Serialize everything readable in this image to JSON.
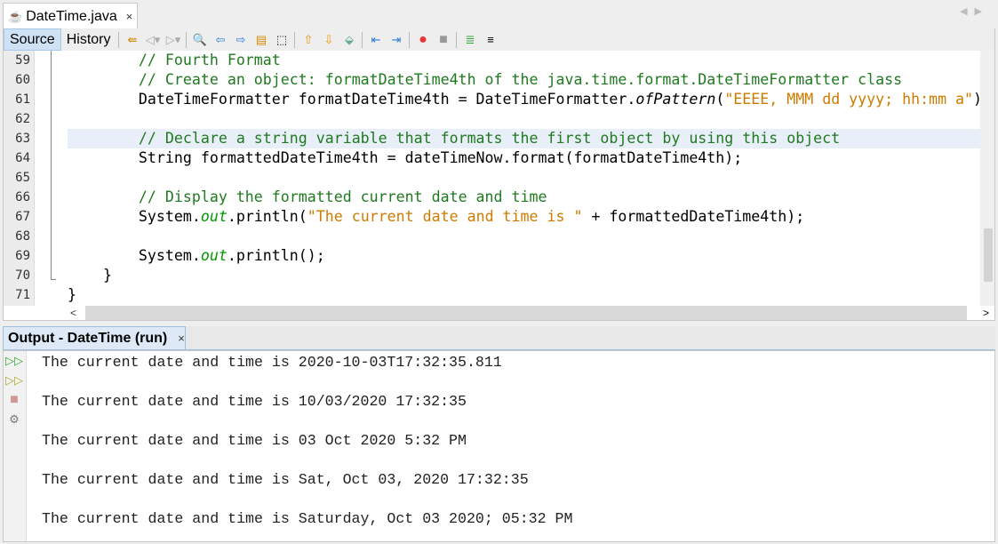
{
  "file_tab": {
    "title": "DateTime.java",
    "close": "×"
  },
  "toolbar": {
    "source": "Source",
    "history": "History",
    "icons": [
      "last-edit-icon",
      "back-icon",
      "forward-icon",
      "find-icon",
      "find-previous-icon",
      "find-next-icon",
      "toggle-highlight-icon",
      "toggle-rectangular-selection-icon",
      "previous-bookmark-icon",
      "next-bookmark-icon",
      "toggle-bookmark-icon",
      "shift-left-icon",
      "shift-right-icon",
      "start-macro-icon",
      "stop-macro-icon",
      "comment-icon",
      "uncomment-icon"
    ]
  },
  "editor": {
    "line_numbers": [
      "59",
      "60",
      "61",
      "62",
      "63",
      "64",
      "65",
      "66",
      "67",
      "68",
      "69",
      "70",
      "71"
    ],
    "highlighted_line": "63",
    "lines": [
      [
        {
          "t": "        // Fourth Format",
          "c": "cmt"
        }
      ],
      [
        {
          "t": "        // Create an object: formatDateTime4th of the java.time.format.DateTimeFormatter class",
          "c": "cmt"
        }
      ],
      [
        {
          "t": "        DateTimeFormatter formatDateTime4th = DateTimeFormatter.",
          "c": ""
        },
        {
          "t": "ofPattern",
          "c": "it"
        },
        {
          "t": "(",
          "c": ""
        },
        {
          "t": "\"EEEE, MMM dd yyyy; hh:mm a\"",
          "c": "str"
        },
        {
          "t": ");",
          "c": ""
        }
      ],
      [],
      [
        {
          "t": "        // Declare a string variable that formats the first object by using this object",
          "c": "cmt"
        }
      ],
      [
        {
          "t": "        String formattedDateTime4th = dateTimeNow.format(formatDateTime4th);",
          "c": ""
        }
      ],
      [],
      [
        {
          "t": "        // Display the formatted current date and time",
          "c": "cmt"
        }
      ],
      [
        {
          "t": "        System.",
          "c": ""
        },
        {
          "t": "out",
          "c": "fld"
        },
        {
          "t": ".println(",
          "c": ""
        },
        {
          "t": "\"The current date and time is \"",
          "c": "str"
        },
        {
          "t": " + formattedDateTime4th);",
          "c": ""
        }
      ],
      [],
      [
        {
          "t": "        System.",
          "c": ""
        },
        {
          "t": "out",
          "c": "fld"
        },
        {
          "t": ".println();",
          "c": ""
        }
      ],
      [
        {
          "t": "    }",
          "c": ""
        }
      ],
      [
        {
          "t": "}",
          "c": ""
        }
      ]
    ]
  },
  "output": {
    "tab_title": "Output - DateTime (run)",
    "close": "×",
    "lines": [
      "The current date and time is 2020-10-03T17:32:35.811",
      "",
      "The current date and time is 10/03/2020 17:32:35",
      "",
      "The current date and time is 03 Oct 2020 5:32 PM",
      "",
      "The current date and time is Sat, Oct 03, 2020 17:32:35",
      "",
      "The current date and time is Saturday, Oct 03 2020; 05:32 PM"
    ],
    "side_icons": [
      "rerun-icon",
      "rerun-with-options-icon",
      "stop-icon",
      "settings-icon"
    ]
  }
}
